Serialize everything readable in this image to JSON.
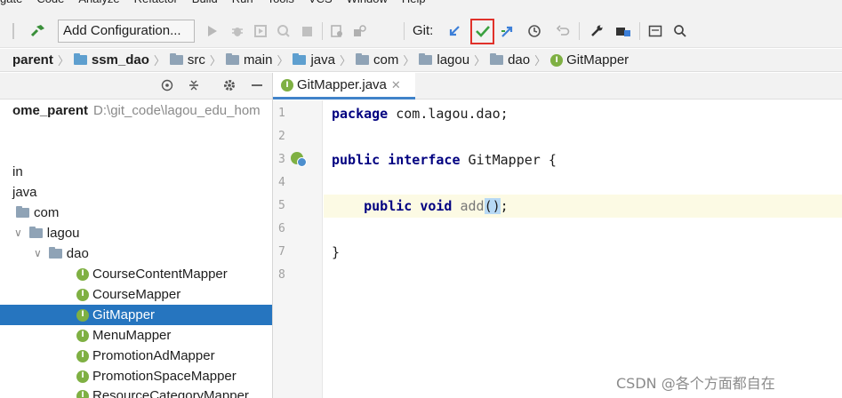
{
  "menubar": {
    "items": [
      "gate",
      "Code",
      "Analyze",
      "Refactor",
      "Build",
      "Run",
      "Tools",
      "VCS",
      "Window",
      "Help"
    ]
  },
  "toolbar": {
    "add_config_label": "Add Configuration...",
    "git_label": "Git:",
    "colors": {
      "update": "#3d7fd8",
      "commit": "#3aa13f",
      "highlight": "#e0312a"
    }
  },
  "breadcrumb": [
    {
      "label": "parent",
      "bold": true
    },
    {
      "label": "ssm_dao",
      "bold": true
    },
    {
      "label": "src"
    },
    {
      "label": "main"
    },
    {
      "label": "java"
    },
    {
      "label": "com"
    },
    {
      "label": "lagou"
    },
    {
      "label": "dao"
    },
    {
      "label": "GitMapper"
    }
  ],
  "project": {
    "root_name": "ome_parent",
    "root_path": "D:\\git_code\\lagou_edu_hom",
    "items": [
      {
        "label": "in"
      },
      {
        "label": "java"
      },
      {
        "label": "com"
      },
      {
        "label": "lagou"
      },
      {
        "label": "dao"
      },
      {
        "label": "CourseContentMapper"
      },
      {
        "label": "CourseMapper"
      },
      {
        "label": "GitMapper",
        "selected": true
      },
      {
        "label": "MenuMapper"
      },
      {
        "label": "PromotionAdMapper"
      },
      {
        "label": "PromotionSpaceMapper"
      },
      {
        "label": "ResourceCategoryMapper"
      }
    ]
  },
  "editor": {
    "tab_label": "GitMapper.java",
    "line_numbers": [
      "1",
      "2",
      "3",
      "4",
      "5",
      "6",
      "7",
      "8"
    ],
    "code": {
      "l1_kw": "package",
      "l1_rest": " com.lagou.dao;",
      "l3_kw1": "public",
      "l3_kw2": "interface",
      "l3_rest": " GitMapper {",
      "l5_kw1": "public",
      "l5_kw2": "void",
      "l5_fn": "add",
      "l5_parens": "()",
      "l5_end": ";",
      "l7": "}"
    }
  },
  "watermark": "CSDN @各个方面都自在"
}
